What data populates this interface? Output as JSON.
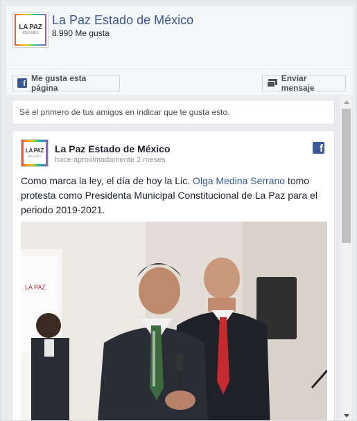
{
  "header": {
    "page_name": "La Paz Estado de México",
    "likes": "8.990 Me gusta",
    "logo_text": "LA PAZ",
    "logo_subtext": "EDO.MEX"
  },
  "actions": {
    "like_label": "Me gusta esta página",
    "message_label": "Enviar mensaje"
  },
  "friends_note": "Sé el primero de tus amigos en indicar que te gusta esto.",
  "post": {
    "author": "La Paz Estado de México",
    "time": "hace aproximadamente 2 meses",
    "text_before": "Como marca la ley, el día de hoy la Lic. ",
    "mention": "Olga Medina Serrano",
    "text_after": " tomo protesta como Presidenta Municipal Constitucional de La Paz para el periodo 2019-2021.",
    "fb_icon": "facebook-icon",
    "photo_sign_text": "LA PAZ"
  },
  "colors": {
    "brand_blue": "#365899",
    "facebook_blue": "#3b5998",
    "background": "#e9ebee"
  }
}
